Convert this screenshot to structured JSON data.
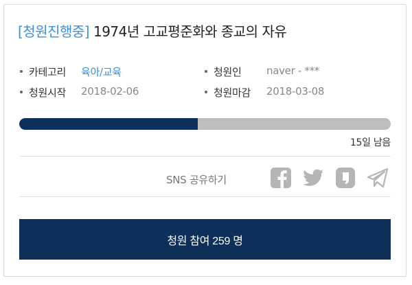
{
  "petition": {
    "status": "[청원진행중]",
    "title": "1974년 고교평준화와 종교의 자유"
  },
  "meta": {
    "category_label": "카테고리",
    "category_value": "육아/교육",
    "author_label": "청원인",
    "author_value": "naver - ***",
    "start_label": "청원시작",
    "start_value": "2018-02-06",
    "end_label": "청원마감",
    "end_value": "2018-03-08"
  },
  "progress": {
    "fraction": 0.48,
    "remaining": "15일 남음"
  },
  "share": {
    "label": "SNS 공유하기",
    "icons": [
      "facebook-icon",
      "twitter-icon",
      "kakaostory-icon",
      "telegram-icon"
    ]
  },
  "cta": {
    "label": "청원 참여 259 명"
  },
  "colors": {
    "accent": "#3c8fe0",
    "navy": "#0e2f5a",
    "track": "#bdbdbd",
    "icon": "#b5b5b5"
  }
}
